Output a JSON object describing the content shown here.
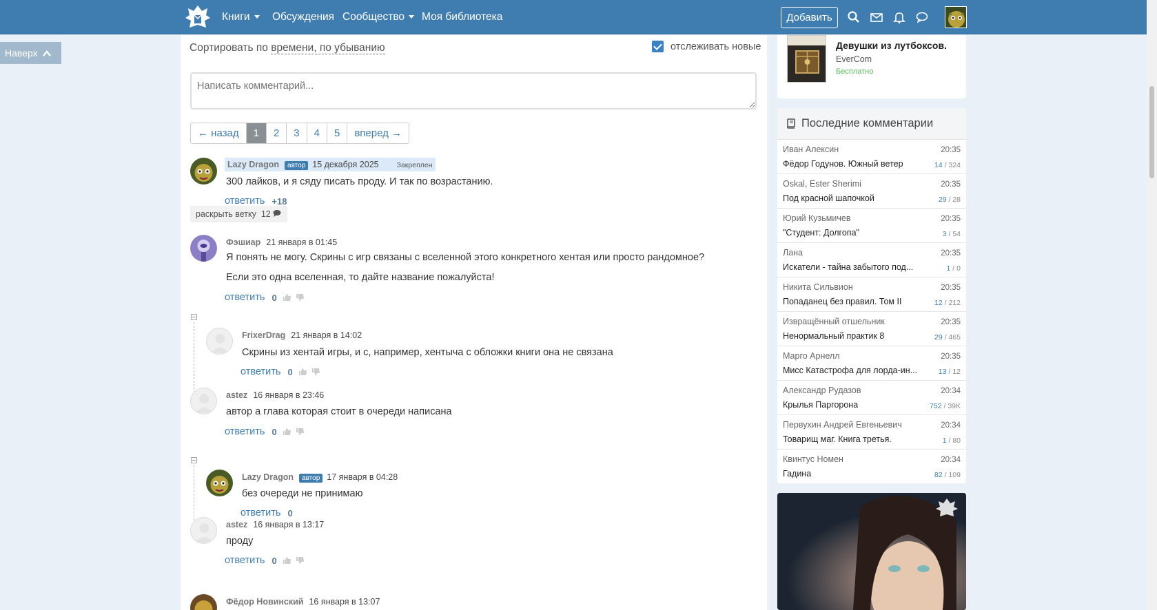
{
  "nav": {
    "items": [
      {
        "label": "Книги",
        "dropdown": true
      },
      {
        "label": "Обсуждения",
        "dropdown": false
      },
      {
        "label": "Сообщество",
        "dropdown": true
      },
      {
        "label": "Моя библиотека",
        "dropdown": false
      }
    ],
    "add_label": "Добавить",
    "icons": [
      "search-icon",
      "mail-icon",
      "bell-icon",
      "chat-icon"
    ]
  },
  "scroll_top_label": "Наверх",
  "sort": {
    "prefix": "Сортировать по",
    "value": "времени, по убыванию"
  },
  "track_new": {
    "label": "отслеживать новые",
    "checked": true
  },
  "comment_placeholder": "Написать комментарий...",
  "pagination": {
    "prev": "← назад",
    "pages": [
      "1",
      "2",
      "3",
      "4",
      "5"
    ],
    "active": "1",
    "next": "вперед →"
  },
  "reply_label": "ответить",
  "author_badge": "автор",
  "comments": [
    {
      "author": "Lazy Dragon",
      "is_author": true,
      "date": "15 декабря 2025",
      "pinned_label": "Закреплен",
      "text": [
        "300 лайков, и я сяду писать проду. И так по возрастанию."
      ],
      "score": "+18"
    },
    {
      "author": "Фэшиар",
      "date": "21 января в 01:45",
      "text": [
        "Я понять не могу. Скрины с игр связаны с вселенной этого конкретного хентая или просто рандомное?",
        "Если это одна вселенная, то дайте название пожалуйста!"
      ],
      "score": "0"
    },
    {
      "author": "FrixerDrag",
      "date": "21 января в 14:02",
      "text": [
        "Скрины из хентай игры, и с, например, хентыча с обложки книги она не связана"
      ],
      "score": "0"
    },
    {
      "author": "astez",
      "date": "16 января в 23:46",
      "text": [
        "автор а глава которая стоит в очереди написана"
      ],
      "score": "0"
    },
    {
      "author": "Lazy Dragon",
      "is_author": true,
      "date": "17 января в 04:28",
      "text": [
        "без очереди не принимаю"
      ],
      "score": "0"
    },
    {
      "author": "astez",
      "date": "16 января в 13:17",
      "text": [
        "проду"
      ],
      "score": "0"
    },
    {
      "author": "Фёдор Новинский",
      "date": "16 января в 13:07",
      "text": [],
      "score": ""
    }
  ],
  "expand_thread": {
    "label": "раскрыть ветку",
    "count": "12"
  },
  "book_card": {
    "title": "Девушки из лутбоксов.",
    "author": "EverCom",
    "price": "Бесплатно"
  },
  "recent_comments": {
    "title": "Последние комментарии",
    "items": [
      {
        "user": "Иван Алексин",
        "time": "20:35",
        "book": "Фёдор Годунов. Южный ветер",
        "new": "14",
        "total": "324"
      },
      {
        "user": "Oskal, Ester Sherimi",
        "time": "20:35",
        "book": "Под красной шапочкой",
        "new": "29",
        "total": "28"
      },
      {
        "user": "Юрий Кузьмичев",
        "time": "20:35",
        "book": "\"Студент: Долгопа\"",
        "new": "3",
        "total": "54"
      },
      {
        "user": "Лана",
        "time": "20:35",
        "book": "Искатели - тайна забытого под...",
        "new": "1",
        "total": "0"
      },
      {
        "user": "Никита Сильвион",
        "time": "20:35",
        "book": "Попаданец без правил. Том II",
        "new": "12",
        "total": "212"
      },
      {
        "user": "Извращённый отшельник",
        "time": "20:35",
        "book": "Ненормальный практик 8",
        "new": "29",
        "total": "465"
      },
      {
        "user": "Марго Арнелл",
        "time": "20:35",
        "book": "Мисс Катастрофа для лорда-ин...",
        "new": "13",
        "total": "12"
      },
      {
        "user": "Александр Рудазов",
        "time": "20:34",
        "book": "Крылья Паргорона",
        "new": "752",
        "total": "39K"
      },
      {
        "user": "Первухин Андрей Евгеньевич",
        "time": "20:34",
        "book": "Товарищ маг. Книга третья.",
        "new": "1",
        "total": "80"
      },
      {
        "user": "Квинтус Номен",
        "time": "20:34",
        "book": "Гадина",
        "new": "82",
        "total": "109"
      }
    ]
  }
}
